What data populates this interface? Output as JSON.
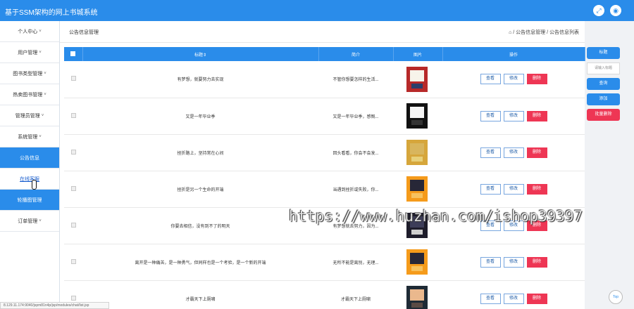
{
  "app": {
    "title": "基于SSM架构的网上书城系统"
  },
  "sidebar": {
    "items": [
      {
        "label": "个人中心",
        "chevron": "˅"
      },
      {
        "label": "用户管理",
        "chevron": "˅"
      },
      {
        "label": "图书类型管理",
        "chevron": "˅"
      },
      {
        "label": "热卖图书管理",
        "chevron": "˅"
      },
      {
        "label": "管理员管理",
        "chevron": "˅"
      },
      {
        "label": "系统管理",
        "chevron": "˅"
      },
      {
        "label": "公告信息",
        "chevron": ""
      },
      {
        "label": "在线客服",
        "chevron": ""
      },
      {
        "label": "轮播图管理",
        "chevron": ""
      },
      {
        "label": "订单管理",
        "chevron": "˅"
      }
    ]
  },
  "page": {
    "title": "公告信息管理",
    "breadcrumb": "⌂ / 公告信息管理 / 公告信息列表"
  },
  "table": {
    "headers": [
      "",
      "标题⇕",
      "简介",
      "图片",
      "操作"
    ],
    "actions": {
      "view": "查看",
      "edit": "修改",
      "delete": "删除"
    },
    "rows": [
      {
        "title": "有梦想，就要努力去实现",
        "intro": "不管你想要怎样的生活...",
        "cover": [
          "#b72929",
          "#f7f4ea",
          "#2b3e6b"
        ]
      },
      {
        "title": "又是一年毕业季",
        "intro": "又是一年毕业季，感慨...",
        "cover": [
          "#111111",
          "#f4f4f4",
          "#333333"
        ]
      },
      {
        "title": "挫折路上，坚持常在心间",
        "intro": "回头看看，你会不会发...",
        "cover": [
          "#d6a63b",
          "#d8b55d",
          "#e7d07a"
        ]
      },
      {
        "title": "挫折是另一个生命的开端",
        "intro": "当遇到挫折或失败，你...",
        "cover": [
          "#f59b1b",
          "#272737",
          "#f7c25f"
        ]
      },
      {
        "title": "你要去相信，没有到不了的明天",
        "intro": "有梦想就去努力，因为...",
        "cover": [
          "#1e1d2b",
          "#3d3d59",
          "#cfcfcf"
        ]
      },
      {
        "title": "离开是一种痛苦，是一种勇气，但同样也是一个考验，是一个新的开端",
        "intro": "无所不能是离别，无理...",
        "cover": [
          "#f59b1b",
          "#272737",
          "#f7c25f"
        ]
      },
      {
        "title": "才霸天下上厕啸",
        "intro": "才霸天下上厕啸",
        "cover": [
          "#1f2b36",
          "#eab88d",
          "#5b4b45"
        ]
      }
    ]
  },
  "right_panel": {
    "title_button": "标题",
    "search_placeholder": "请输入标题",
    "query_button": "查询",
    "add_button": "添加",
    "batch_delete_button": "批量删除"
  },
  "status": {
    "url": "8.129.11.174:9040/jspm81n4p/jsp/modules/chat/list.jsp"
  },
  "watermark": "https://www.huzhan.com/ishop39397",
  "top_button": "Top"
}
